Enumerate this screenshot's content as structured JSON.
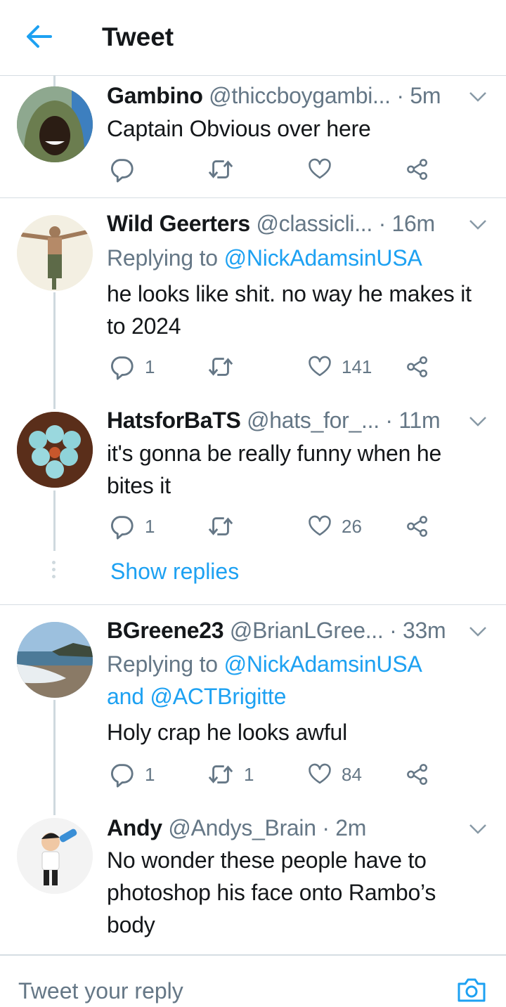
{
  "header": {
    "title": "Tweet"
  },
  "tweets": [
    {
      "name": "Gambino",
      "handle": "@thiccboygambi...",
      "time": "· 5m",
      "text": "Captain Obvious over here",
      "replies": "",
      "retweets": "",
      "likes": ""
    },
    {
      "name": "Wild Geerters",
      "handle": "@classicli...",
      "time": "· 16m",
      "replying_prefix": "Replying to",
      "replying_to": "@NickAdamsinUSA",
      "text": "he looks like shit. no way he makes it to 2024",
      "replies": "1",
      "retweets": "",
      "likes": "141"
    },
    {
      "name": "HatsforBaTS",
      "handle": "@hats_for_...",
      "time": "· 11m",
      "text": "it's gonna be really funny when he bites it",
      "replies": "1",
      "retweets": "",
      "likes": "26"
    },
    {
      "name": "BGreene23",
      "handle": "@BrianLGree...",
      "time": "· 33m",
      "replying_prefix": "Replying to",
      "replying_to": "@NickAdamsinUSA",
      "replying_and": "and",
      "replying_to2": "@ACTBrigitte",
      "text": "Holy crap he looks awful",
      "replies": "1",
      "retweets": "1",
      "likes": "84"
    },
    {
      "name": "Andy",
      "handle": "@Andys_Brain",
      "time": "· 2m",
      "text": "No wonder these people have to photoshop his face onto Rambo’s body"
    }
  ],
  "show_replies": "Show replies",
  "composer": {
    "placeholder": "Tweet your reply"
  },
  "colors": {
    "accent": "#1da1f2",
    "secondary_text": "#657786",
    "divider": "#d6dde3"
  },
  "icons": [
    "back-arrow-icon",
    "reply-icon",
    "retweet-icon",
    "like-icon",
    "share-icon",
    "chevron-down-icon",
    "camera-icon"
  ]
}
